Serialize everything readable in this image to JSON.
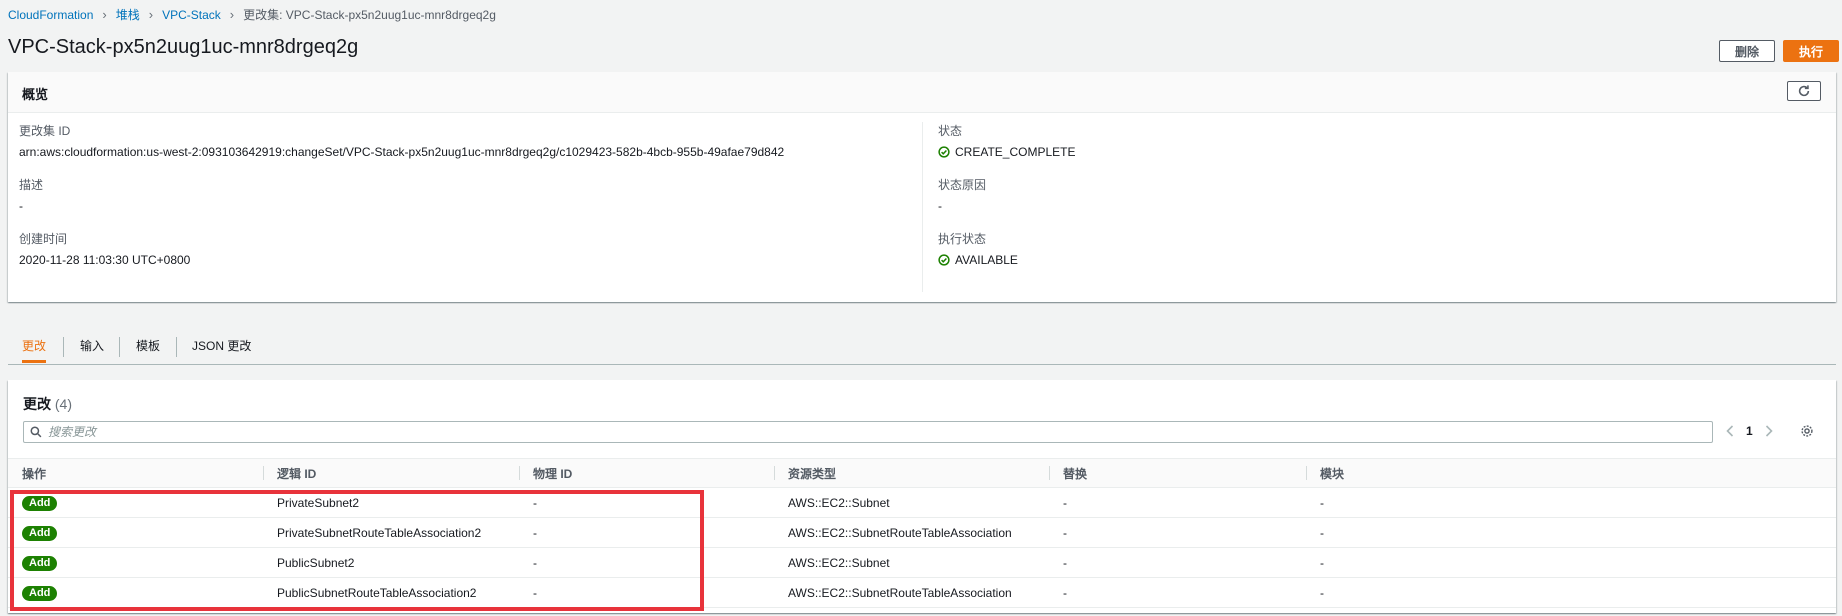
{
  "breadcrumb": {
    "items": [
      "CloudFormation",
      "堆栈",
      "VPC-Stack"
    ],
    "current": "更改集: VPC-Stack-px5n2uug1uc-mnr8drgeq2g"
  },
  "page": {
    "title": "VPC-Stack-px5n2uug1uc-mnr8drgeq2g",
    "delete_label": "删除",
    "execute_label": "执行"
  },
  "overview": {
    "title": "概览",
    "changeset_id_label": "更改集 ID",
    "changeset_id": "arn:aws:cloudformation:us-west-2:093103642919:changeSet/VPC-Stack-px5n2uug1uc-mnr8drgeq2g/c1029423-582b-4bcb-955b-49afae79d842",
    "description_label": "描述",
    "description": "-",
    "created_label": "创建时间",
    "created": "2020-11-28 11:03:30 UTC+0800",
    "status_label": "状态",
    "status": "CREATE_COMPLETE",
    "status_reason_label": "状态原因",
    "status_reason": "-",
    "exec_status_label": "执行状态",
    "exec_status": "AVAILABLE"
  },
  "tabs": [
    "更改",
    "输入",
    "模板",
    "JSON 更改"
  ],
  "changes": {
    "title": "更改",
    "count": "(4)",
    "search_placeholder": "搜索更改",
    "page": "1",
    "columns": [
      "操作",
      "逻辑 ID",
      "物理 ID",
      "资源类型",
      "替换",
      "模块"
    ],
    "rows": [
      {
        "action": "Add",
        "logical_id": "PrivateSubnet2",
        "physical_id": "-",
        "type": "AWS::EC2::Subnet",
        "replace": "-",
        "module": "-"
      },
      {
        "action": "Add",
        "logical_id": "PrivateSubnetRouteTableAssociation2",
        "physical_id": "-",
        "type": "AWS::EC2::SubnetRouteTableAssociation",
        "replace": "-",
        "module": "-"
      },
      {
        "action": "Add",
        "logical_id": "PublicSubnet2",
        "physical_id": "-",
        "type": "AWS::EC2::Subnet",
        "replace": "-",
        "module": "-"
      },
      {
        "action": "Add",
        "logical_id": "PublicSubnetRouteTableAssociation2",
        "physical_id": "-",
        "type": "AWS::EC2::SubnetRouteTableAssociation",
        "replace": "-",
        "module": "-"
      }
    ]
  },
  "colors": {
    "accent": "#ec7211",
    "link": "#0073bb",
    "success": "#1d8102",
    "highlight": "#e8333b"
  }
}
